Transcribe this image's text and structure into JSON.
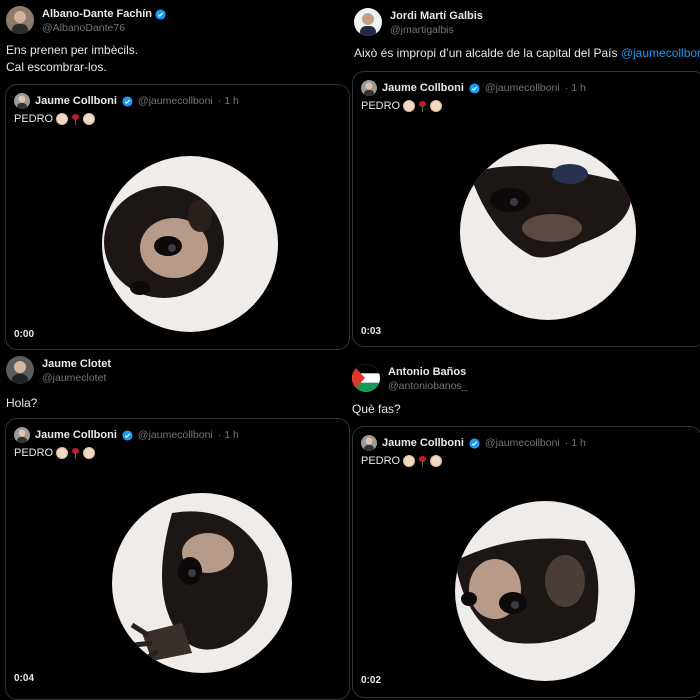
{
  "panels": [
    {
      "author_name": "Albano-Dante Fachín",
      "author_handle": "@AlbanoDante76",
      "author_verified": true,
      "text_line1": "Ens prenen per imbècils.",
      "text_line2": "Cal escombrar-los.",
      "quote": {
        "name": "Jaume Collboni",
        "handle": "@jaumecollboni",
        "time": "· 1 h",
        "text": "PEDRO",
        "video_time": "0:00"
      }
    },
    {
      "author_name": "Jordi Martí Galbis",
      "author_handle": "@jmartigalbis",
      "author_verified": false,
      "text_plain": "Això és impropi d’un alcalde de la capital del País ",
      "text_mention": "@jaumecollboni",
      "quote": {
        "name": "Jaume Collboni",
        "handle": "@jaumecollboni",
        "time": "· 1 h",
        "text": "PEDRO",
        "video_time": "0:03"
      }
    },
    {
      "author_name": "Jaume Clotet",
      "author_handle": "@jaumeclotet",
      "author_verified": false,
      "text_line1": "Hola?",
      "quote": {
        "name": "Jaume Collboni",
        "handle": "@jaumecollboni",
        "time": "· 1 h",
        "text": "PEDRO",
        "video_time": "0:04"
      }
    },
    {
      "author_name": "Antonio Baños",
      "author_handle": "@antoniobanos_",
      "author_verified": false,
      "text_line1": "Què fas?",
      "quote": {
        "name": "Jaume Collboni",
        "handle": "@jaumecollboni",
        "time": "· 1 h",
        "text": "PEDRO",
        "video_time": "0:02"
      }
    }
  ],
  "colors": {
    "background": "#000000",
    "text": "#e7e9ea",
    "muted": "#71767b",
    "link": "#1d9bf0",
    "border": "#2f3336",
    "verified": "#1d9bf0"
  },
  "icons": [
    "verified-badge-icon",
    "clapping-hands-emoji",
    "rose-emoji",
    "palestine-flag-avatar"
  ]
}
